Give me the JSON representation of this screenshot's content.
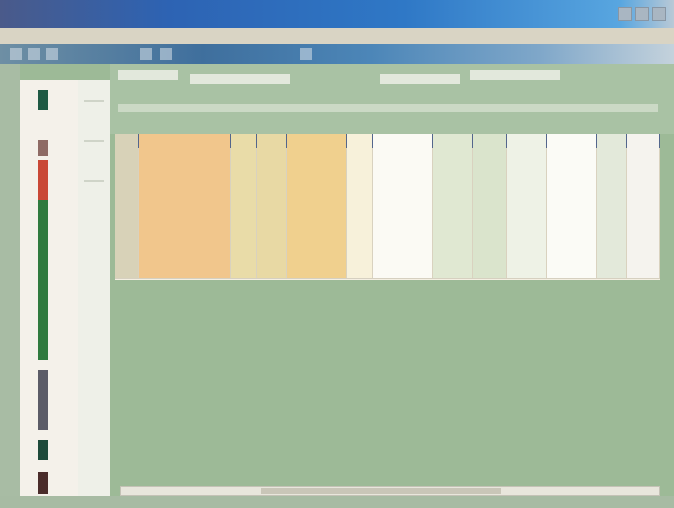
{
  "window": {
    "title": ""
  },
  "menu": {
    "items": [
      "",
      "",
      "",
      "",
      ""
    ]
  },
  "header": {
    "fields": [
      "",
      "",
      "",
      ""
    ]
  },
  "grid": {
    "columns": [
      "",
      "",
      "",
      "",
      "",
      "",
      "",
      "",
      "",
      "",
      "",
      "",
      ""
    ],
    "rows": [
      [
        "",
        "",
        "",
        "",
        "",
        "",
        "",
        "",
        "",
        "",
        "",
        "",
        ""
      ],
      [
        "",
        "",
        "",
        "",
        "",
        "",
        "",
        "",
        "",
        "",
        "",
        "",
        ""
      ],
      [
        "",
        "",
        "",
        "",
        "",
        "",
        "",
        "",
        "",
        "",
        "",
        "",
        ""
      ],
      [
        "",
        "",
        "",
        "",
        "",
        "",
        "",
        "",
        "",
        "",
        "",
        "",
        ""
      ],
      [
        "",
        "",
        "",
        "",
        "",
        "",
        "",
        "",
        "",
        "",
        "",
        "",
        ""
      ],
      [
        "",
        "",
        "",
        "",
        "",
        "",
        "",
        "",
        "",
        "",
        "",
        "",
        ""
      ],
      [
        "",
        "",
        "",
        "",
        "",
        "",
        "",
        "",
        "",
        "",
        "",
        "",
        ""
      ],
      [
        "",
        "",
        "",
        "",
        "",
        "",
        "",
        "",
        "",
        "",
        "",
        "",
        ""
      ],
      [
        "",
        "",
        "",
        "",
        "",
        "",
        "",
        "",
        "",
        "",
        "",
        "",
        ""
      ],
      [
        "",
        "",
        "",
        "",
        "",
        "",
        "",
        "",
        "",
        "",
        "",
        "",
        ""
      ],
      [
        "",
        "",
        "",
        "",
        "",
        "",
        "",
        "",
        "",
        "",
        "",
        "",
        ""
      ],
      [
        "",
        "",
        "",
        "",
        "",
        "",
        "",
        "",
        "",
        "",
        "",
        "",
        ""
      ],
      [
        "",
        "",
        "",
        "",
        "",
        "",
        "",
        "",
        "",
        "",
        "",
        "",
        ""
      ]
    ]
  },
  "colors": {
    "header_bg": "#2b3f66",
    "workspace_bg": "#9dba97",
    "row_highlight": "#f1c68c"
  },
  "icons": [
    "close-icon",
    "maximize-icon",
    "minimize-icon"
  ]
}
